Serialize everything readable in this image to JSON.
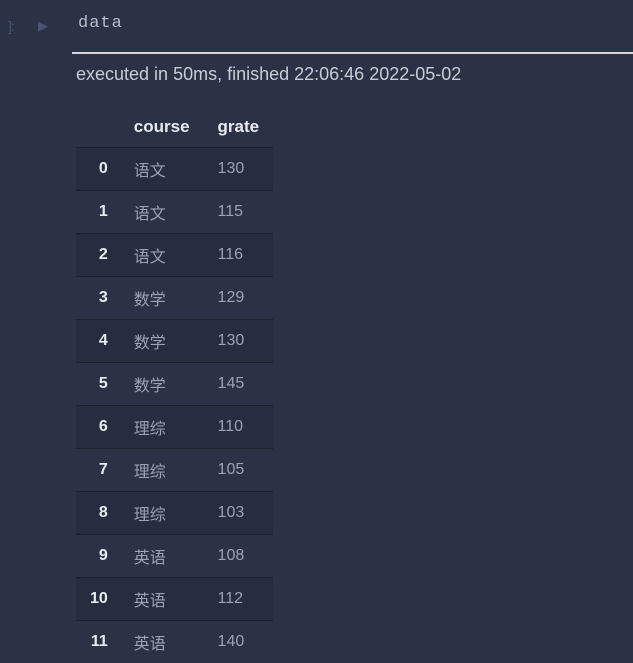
{
  "input": {
    "indicator": "]:",
    "arrow": "▶",
    "code": "data"
  },
  "exec_status": "executed in 50ms, finished 22:06:46 2022-05-02",
  "table": {
    "columns": [
      "course",
      "grate"
    ],
    "index": [
      "0",
      "1",
      "2",
      "3",
      "4",
      "5",
      "6",
      "7",
      "8",
      "9",
      "10",
      "11"
    ],
    "rows": [
      {
        "course": "语文",
        "grate": "130"
      },
      {
        "course": "语文",
        "grate": "115"
      },
      {
        "course": "语文",
        "grate": "116"
      },
      {
        "course": "数学",
        "grate": "129"
      },
      {
        "course": "数学",
        "grate": "130"
      },
      {
        "course": "数学",
        "grate": "145"
      },
      {
        "course": "理综",
        "grate": "110"
      },
      {
        "course": "理综",
        "grate": "105"
      },
      {
        "course": "理综",
        "grate": "103"
      },
      {
        "course": "英语",
        "grate": "108"
      },
      {
        "course": "英语",
        "grate": "112"
      },
      {
        "course": "英语",
        "grate": "140"
      }
    ]
  }
}
